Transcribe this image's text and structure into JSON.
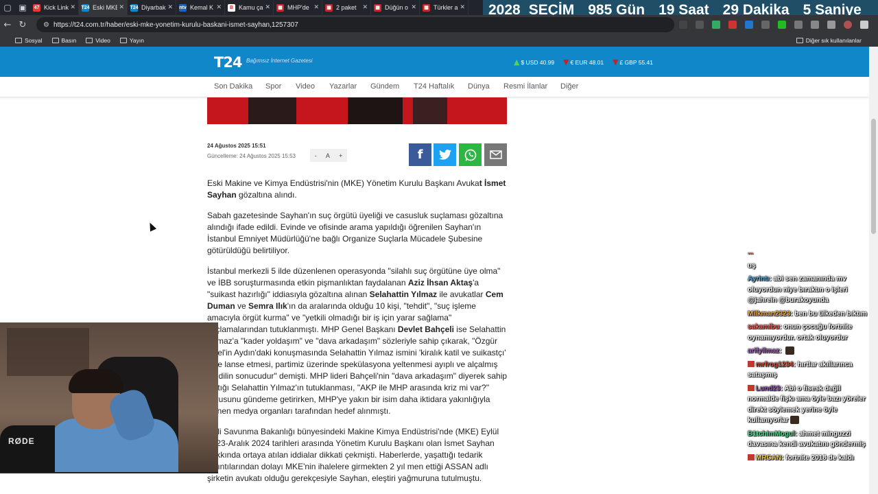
{
  "browser": {
    "tabs": [
      {
        "title": "Kick Link",
        "fav_color": "#e53935",
        "fav_text": "47",
        "active": false
      },
      {
        "title": "Eski MKE",
        "fav_color": "#0f87c9",
        "fav_text": "T24",
        "active": true
      },
      {
        "title": "Diyarbak",
        "fav_color": "#0f87c9",
        "fav_text": "T24",
        "active": false
      },
      {
        "title": "Kemal K",
        "fav_color": "#1565c0",
        "fav_text": "ntv",
        "active": false
      },
      {
        "title": "Kamu ça",
        "fav_color": "#ffffff",
        "fav_text": "B",
        "active": false
      },
      {
        "title": "MHP'de",
        "fav_color": "#c62828",
        "fav_text": "▦",
        "active": false
      },
      {
        "title": "2 paket",
        "fav_color": "#c62828",
        "fav_text": "▦",
        "active": false
      },
      {
        "title": "Düğün o",
        "fav_color": "#c62828",
        "fav_text": "▦",
        "active": false
      },
      {
        "title": "Türkler a",
        "fav_color": "#c62828",
        "fav_text": "▦",
        "active": false
      }
    ],
    "url": "https://t24.com.tr/haber/eski-mke-yonetim-kurulu-baskani-ismet-sayhan,1257307",
    "bookmarks": [
      "Sosyal",
      "Basın",
      "Video",
      "Yayın"
    ],
    "other_bookmarks": "Diğer sık kullanılanlar"
  },
  "countdown": {
    "year": "2028",
    "label": "SEÇİM",
    "days": "985 Gün",
    "hours": "19 Saat",
    "minutes": "29 Dakika",
    "seconds": "5 Saniye"
  },
  "site": {
    "logo": "T24",
    "tagline": "Bağımsız İnternet Gazetesi",
    "fx": [
      {
        "label": "$ USD 40.99",
        "dir": "up"
      },
      {
        "label": "€ EUR 48.01",
        "dir": "down"
      },
      {
        "label": "£ GBP 55.41",
        "dir": "down"
      }
    ],
    "menu": [
      "Son Dakika",
      "Spor",
      "Video",
      "Yazarlar",
      "Gündem",
      "T24 Haftalık",
      "Dünya",
      "Resmi İlanlar",
      "Diğer"
    ]
  },
  "article": {
    "date": "24 Ağustos 2025 15:51",
    "updated": "Güncelleme: 24 Ağustos 2025 15:53",
    "font_controls": [
      "-",
      "A",
      "+"
    ],
    "p1": [
      "Eski Makine ve Kimya Endüstrisi'nin (MKE) Yönetim Kurulu Başkanı Avuka",
      "t İsmet Sayhan",
      " gözaltına alındı."
    ],
    "p2": "Sabah gazetesinde Sayhan'ın suç örgütü üyeliği ve casusluk suçlaması gözaltına alındığı ifade edildi. Evinde ve ofisinde arama yapıldığı öğrenilen Sayhan'ın İstanbul Emniyet Müdürlüğü'ne bağlı Organize Suçlarla Mücadele Şubesine götürüldüğü belirtiliyor.",
    "p3": [
      "İstanbul merkezli 5 ilde düzenlenen operasyonda \"silahlı suç örgütüne üye olma\" ve İBB soruşturmasında etkin pişmanlıktan faydalanan ",
      "Aziz İhsan Aktaş",
      "'a \"suikast hazırlığı\" iddiasıyla gözaltına alınan ",
      "Selahattin Yılmaz",
      " ile avukatlar ",
      "Cem Duman",
      " ve ",
      "Semra Ilık",
      "'ın da aralarında olduğu 10 kişi, \"tehdit\", \"suç işleme amacıyla örgüt kurma\" ve \"yetkili olmadığı bir iş için yarar sağlama\" suçlamalarından tutuklanmıştı. MHP Genel Başkanı ",
      "Devlet Bahçeli",
      " ise Selahattin Yılmaz'a \"kader yoldaşım\" ve \"dava arkadaşım\" sözleriyle sahip çıkarak, \"Özgür Özel'in Aydın'daki konuşmasında Selahattin Yılmaz ismini 'kiralık katil ve suikastçı' diye lanse etmesi, partimiz üzerinde spekülasyona yeltenmesi ayıplı ve alçalmış bir dilin sonucudur\" demişti. MHP lideri Bahçeli'nin \"dava arkadaşım\" diyerek sahip çıktığı Selahattin Yılmaz'ın tutuklanması, \"AKP ile MHP arasında kriz mi var?\" sorusunu gündeme getirirken, MHP'ye yakın bir isim daha iktidara yakınlığıyla bilinen medya organları tarafından hedef alınmıştı."
    ],
    "p4": "Milli Savunma Bakanlığı bünyesindeki Makine Kimya Endüstrisi'nde (MKE) Eylül 2023-Aralık 2024 tarihleri arasında Yönetim Kurulu Başkanı olan İsmet Sayhan hakkında ortaya atılan iddialar dikkati çekmişti. Haberlerde, yaşattığı tedarik sıkıntılarından dolayı MKE'nin ihalelere girmekten 2 yıl men ettiği ASSAN adlı şirketin avukatı olduğu gerekçesiyle Sayhan, eleştiri yağmuruna tutulmuştu."
  },
  "webcam": {
    "mic_brand": "RØDE"
  },
  "chat": [
    {
      "user": "",
      "text": "...",
      "user_color": "#ff4444",
      "badge": false
    },
    {
      "user": "",
      "text": "uş",
      "user_color": "#ffffff",
      "badge": false
    },
    {
      "user": "Ayrintı",
      "text": "abi sen zamanında mv oluyordun niye bıraktın o işleri @jahrein @burakoyunda",
      "user_color": "#5dade2",
      "badge": false
    },
    {
      "user": "Milkman2323",
      "text": "ben bu ülkeden bıktım",
      "user_color": "#f5b041",
      "badge": false
    },
    {
      "user": "sakamibu",
      "text": "onun çocuğu fortnite oynamıyordur. ortak oluyordur",
      "user_color": "#ec7063",
      "badge": false
    },
    {
      "user": "arifyilmaz",
      "text": "",
      "user_color": "#a569bd",
      "badge": false,
      "emote": true
    },
    {
      "user": "mrfrog1234",
      "text": "hırtlar akıllarınca sataşmış",
      "user_color": "#e74c3c",
      "badge": true
    },
    {
      "user": "Lund23",
      "text": "Abi o fisesk değil normalde fişkı ama öyle bazı yöreler direkt söylemek yerine öyle kullanıyorlar",
      "user_color": "#9b59b6",
      "badge": true,
      "emote": true
    },
    {
      "user": "B1tchimMogul",
      "text": "ahmet minguzzi davasına kendi avukatını göndermiş",
      "user_color": "#58d68d",
      "badge": false
    },
    {
      "user": "MRCAN",
      "text": "fortnite 2018 de kaldı",
      "user_color": "#f4d03f",
      "badge": true
    }
  ]
}
